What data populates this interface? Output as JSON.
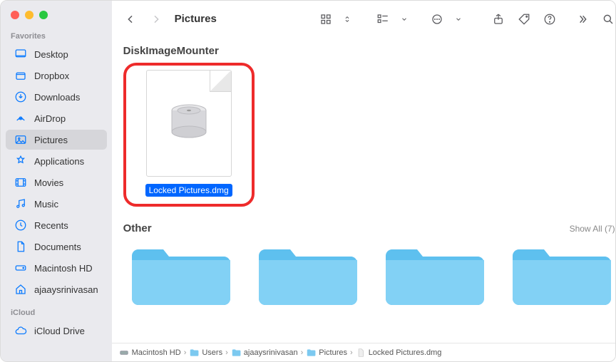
{
  "window": {
    "title": "Pictures"
  },
  "sidebar": {
    "sections": [
      {
        "heading": "Favorites",
        "items": [
          {
            "icon": "desktop",
            "label": "Desktop"
          },
          {
            "icon": "dropbox",
            "label": "Dropbox"
          },
          {
            "icon": "download",
            "label": "Downloads"
          },
          {
            "icon": "airdrop",
            "label": "AirDrop"
          },
          {
            "icon": "pictures",
            "label": "Pictures",
            "active": true
          },
          {
            "icon": "apps",
            "label": "Applications"
          },
          {
            "icon": "movies",
            "label": "Movies"
          },
          {
            "icon": "music",
            "label": "Music"
          },
          {
            "icon": "recents",
            "label": "Recents"
          },
          {
            "icon": "documents",
            "label": "Documents"
          },
          {
            "icon": "hd",
            "label": "Macintosh HD"
          },
          {
            "icon": "home",
            "label": "ajaaysrinivasan"
          }
        ]
      },
      {
        "heading": "iCloud",
        "items": [
          {
            "icon": "cloud",
            "label": "iCloud Drive"
          }
        ]
      }
    ]
  },
  "sections": {
    "group1": {
      "heading": "DiskImageMounter"
    },
    "selected_file": {
      "name": "Locked Pictures.dmg"
    },
    "group2": {
      "heading": "Other",
      "show_all_label": "Show All (7)"
    }
  },
  "pathbar": {
    "items": [
      {
        "icon": "disk",
        "label": "Macintosh HD"
      },
      {
        "icon": "folder",
        "label": "Users"
      },
      {
        "icon": "folder",
        "label": "ajaaysrinivasan"
      },
      {
        "icon": "folder",
        "label": "Pictures"
      },
      {
        "icon": "file",
        "label": "Locked Pictures.dmg"
      }
    ]
  }
}
